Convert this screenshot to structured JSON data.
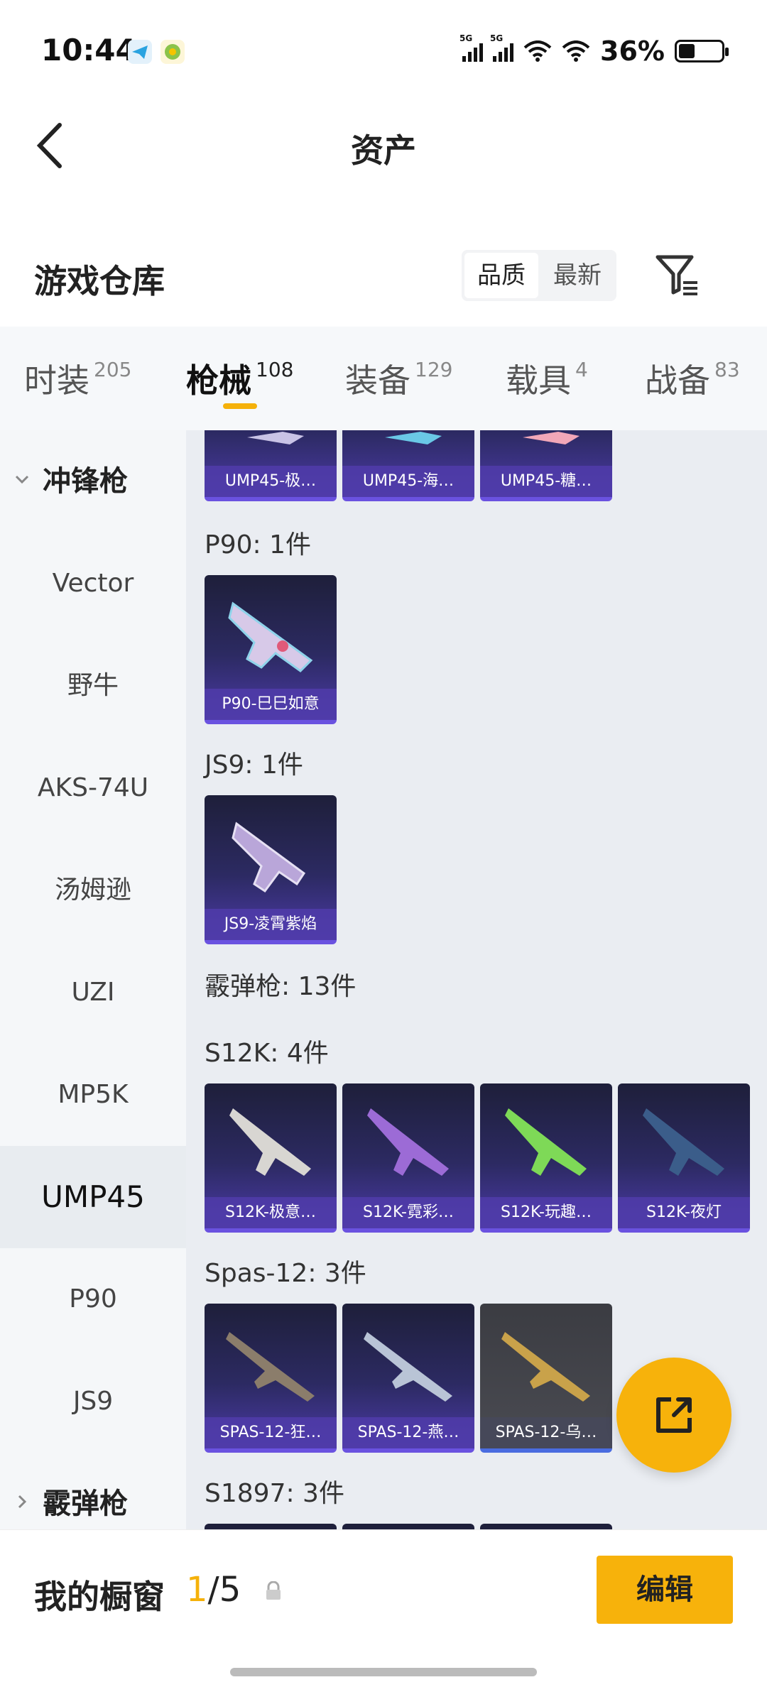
{
  "status_bar": {
    "time": "10:44",
    "signal1": "5G",
    "signal2": "5G",
    "battery": "36%"
  },
  "header": {
    "title": "资产"
  },
  "warehouse": {
    "title": "游戏仓库",
    "sort_quality": "品质",
    "sort_latest": "最新"
  },
  "tabs": [
    {
      "label": "时装",
      "count": "205"
    },
    {
      "label": "枪械",
      "count": "108",
      "active": true
    },
    {
      "label": "装备",
      "count": "129"
    },
    {
      "label": "载具",
      "count": "4"
    },
    {
      "label": "战备",
      "count": "83"
    }
  ],
  "sidebar": {
    "group_smg": "冲锋枪",
    "items": [
      "Vector",
      "野牛",
      "AKS-74U",
      "汤姆逊",
      "UZI",
      "MP5K",
      "UMP45",
      "P90",
      "JS9"
    ],
    "selected": "UMP45",
    "group_shotgun": "霰弹枪"
  },
  "content": {
    "ump_cards": [
      "UMP45-极…",
      "UMP45-海…",
      "UMP45-糖…"
    ],
    "p90": {
      "title": "P90: 1件",
      "cards": [
        "P90-巳巳如意"
      ]
    },
    "js9": {
      "title": "JS9: 1件",
      "cards": [
        "JS9-凌霄紫焰"
      ]
    },
    "shotgun_title": "霰弹枪: 13件",
    "s12k": {
      "title": "S12K: 4件",
      "cards": [
        "S12K-极意…",
        "S12K-霓彩…",
        "S12K-玩趣…",
        "S12K-夜灯"
      ]
    },
    "spas": {
      "title": "Spas-12: 3件",
      "cards": [
        "SPAS-12-狂…",
        "SPAS-12-燕…",
        "SPAS-12-乌…"
      ]
    },
    "s1897": {
      "title": "S1897: 3件"
    }
  },
  "bottom": {
    "title": "我的橱窗",
    "count_current": "1",
    "count_total": "/5",
    "edit": "编辑"
  },
  "colors": {
    "accent": "#f7b20b",
    "card_purple": "#4b3aa6"
  }
}
